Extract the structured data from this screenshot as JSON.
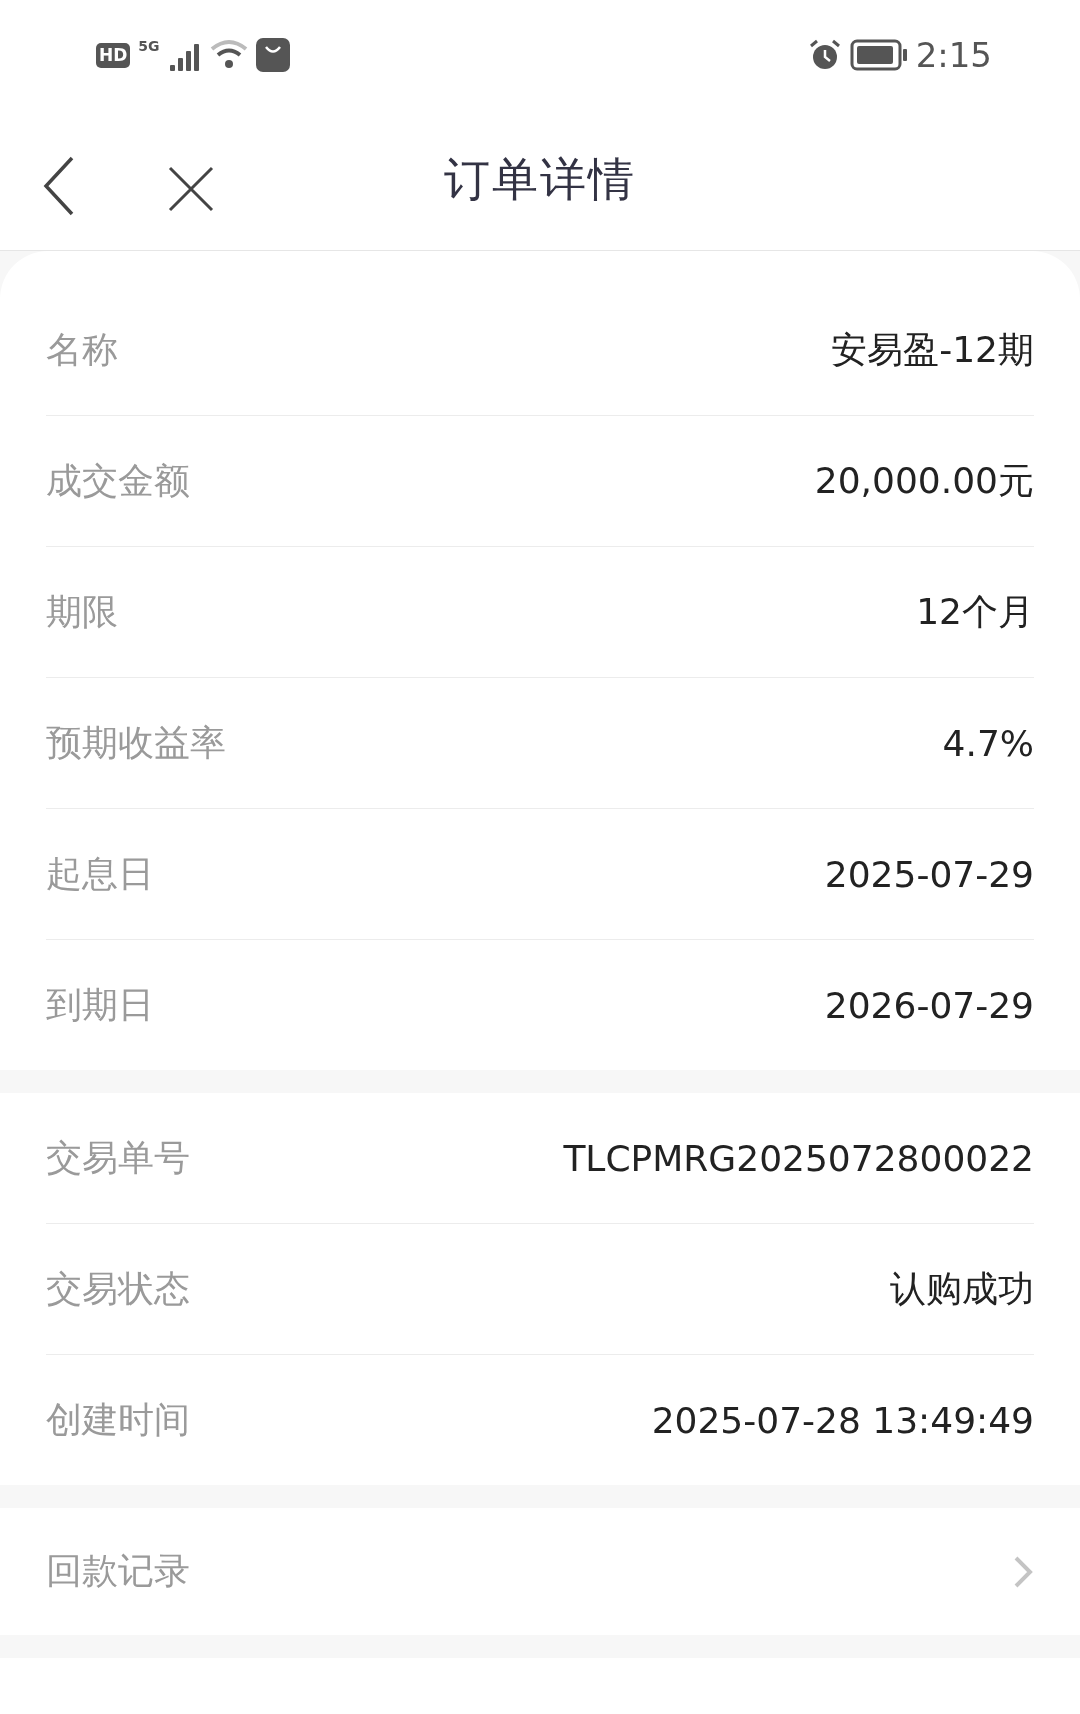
{
  "status_bar": {
    "hd": "HD",
    "network": "5G",
    "time": "2:15"
  },
  "header": {
    "title": "订单详情"
  },
  "sections": [
    {
      "kind": "fields",
      "rounded": true,
      "rows": [
        {
          "label": "名称",
          "value": "安易盈-12期"
        },
        {
          "label": "成交金额",
          "value": "20,000.00元"
        },
        {
          "label": "期限",
          "value": "12个月"
        },
        {
          "label": "预期收益率",
          "value": "4.7%"
        },
        {
          "label": "起息日",
          "value": "2025-07-29"
        },
        {
          "label": "到期日",
          "value": "2026-07-29"
        }
      ]
    },
    {
      "kind": "fields",
      "rounded": false,
      "rows": [
        {
          "label": "交易单号",
          "value": "TLCPMRG2025072800022"
        },
        {
          "label": "交易状态",
          "value": "认购成功"
        },
        {
          "label": "创建时间",
          "value": "2025-07-28 13:49:49"
        }
      ]
    },
    {
      "kind": "link",
      "label": "回款记录"
    },
    {
      "kind": "blank"
    }
  ]
}
